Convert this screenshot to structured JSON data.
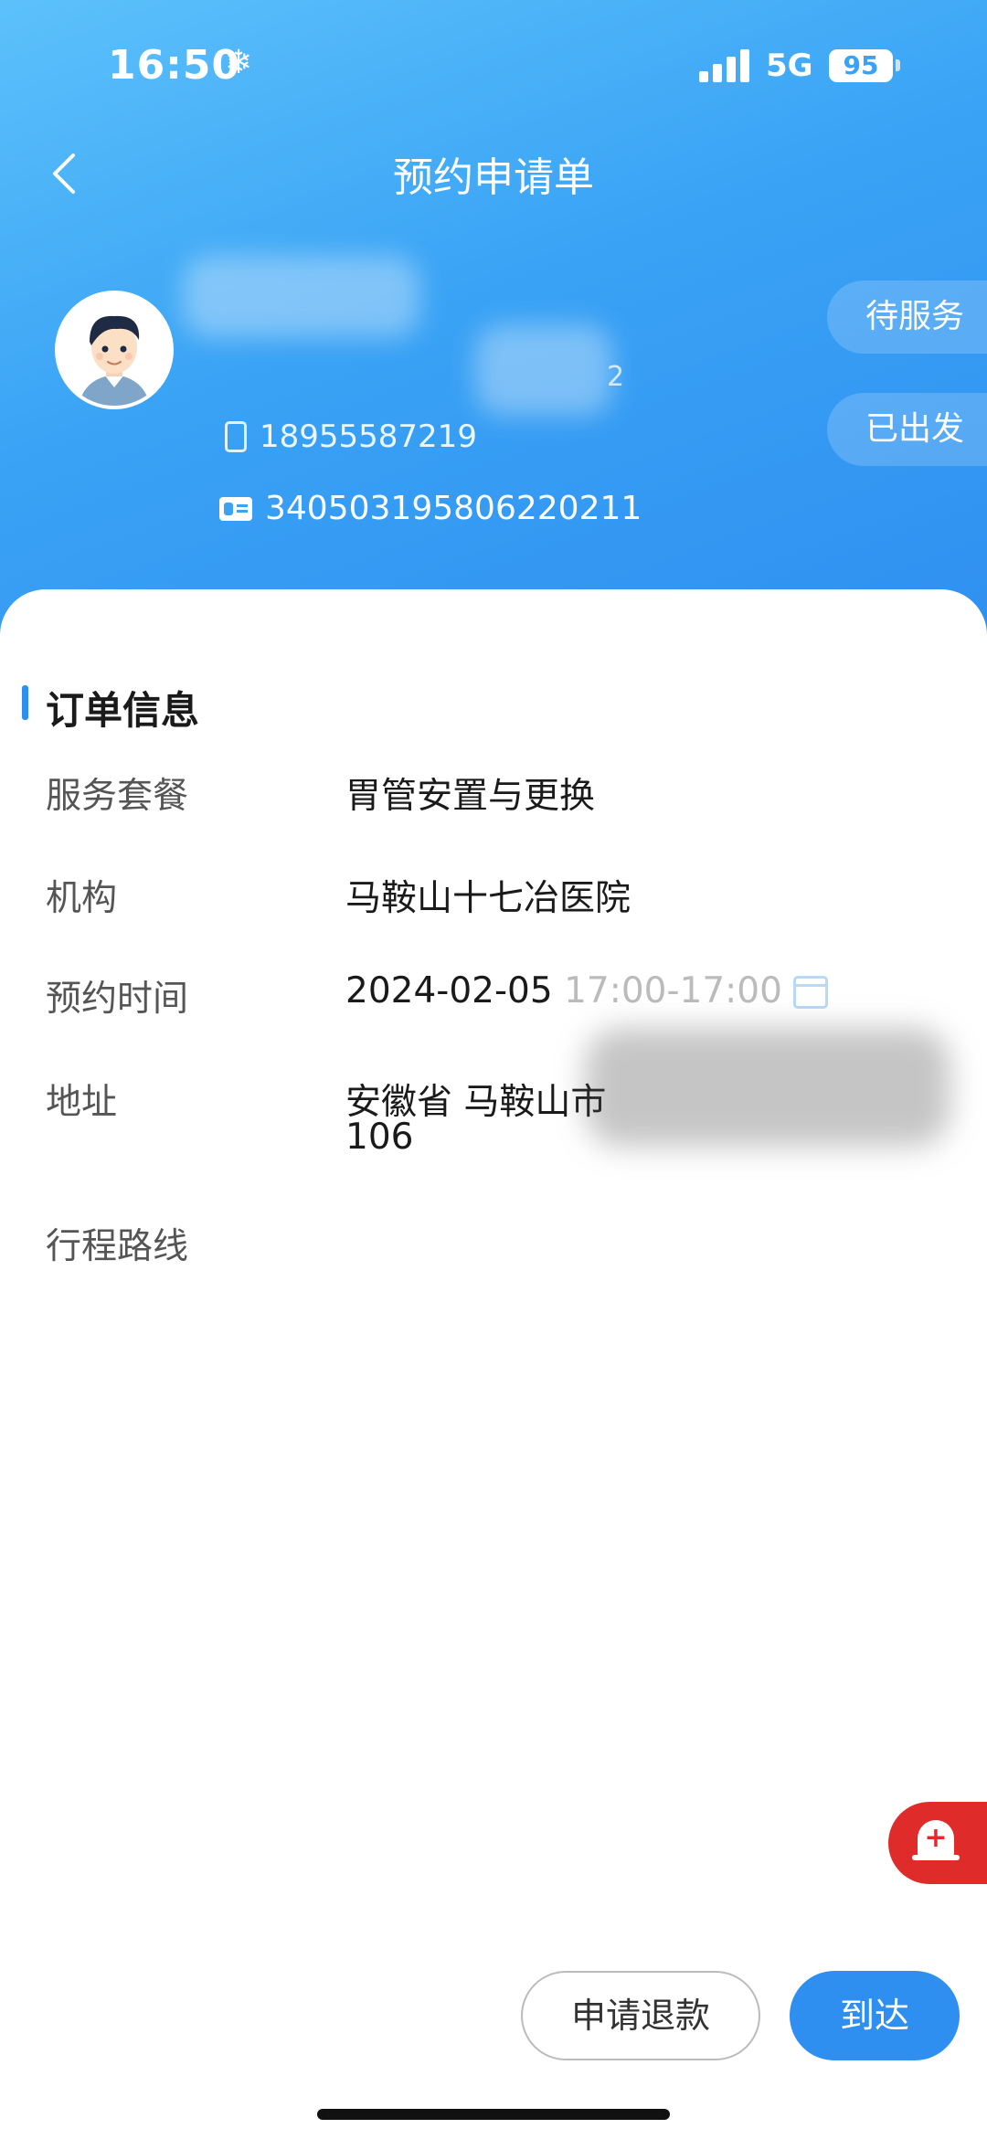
{
  "status_bar": {
    "time": "16:50",
    "snow_icon": "❄",
    "network": "5G",
    "battery": "95"
  },
  "nav": {
    "title": "预约申请单",
    "back_icon": "chevron-left-icon"
  },
  "profile": {
    "name_suffix": "2",
    "phone": "18955587219",
    "id_number": "340503195806220211"
  },
  "status_tags": [
    "待服务",
    "已出发"
  ],
  "order": {
    "section_title": "订单信息",
    "rows": [
      {
        "label": "服务套餐",
        "value": "胃管安置与更换"
      },
      {
        "label": "机构",
        "value": "马鞍山十七冶医院"
      },
      {
        "label": "预约时间",
        "date": "2024-02-05",
        "time": "17:00-17:00"
      },
      {
        "label": "地址",
        "value": "安徽省 马鞍山市",
        "value2": "106"
      },
      {
        "label": "行程路线",
        "value": ""
      }
    ]
  },
  "actions": {
    "refund_label": "申请退款",
    "arrive_label": "到达"
  },
  "colors": {
    "primary": "#2f8ff0",
    "header_light": "#5cc1fb",
    "sos": "#e02b2b"
  }
}
